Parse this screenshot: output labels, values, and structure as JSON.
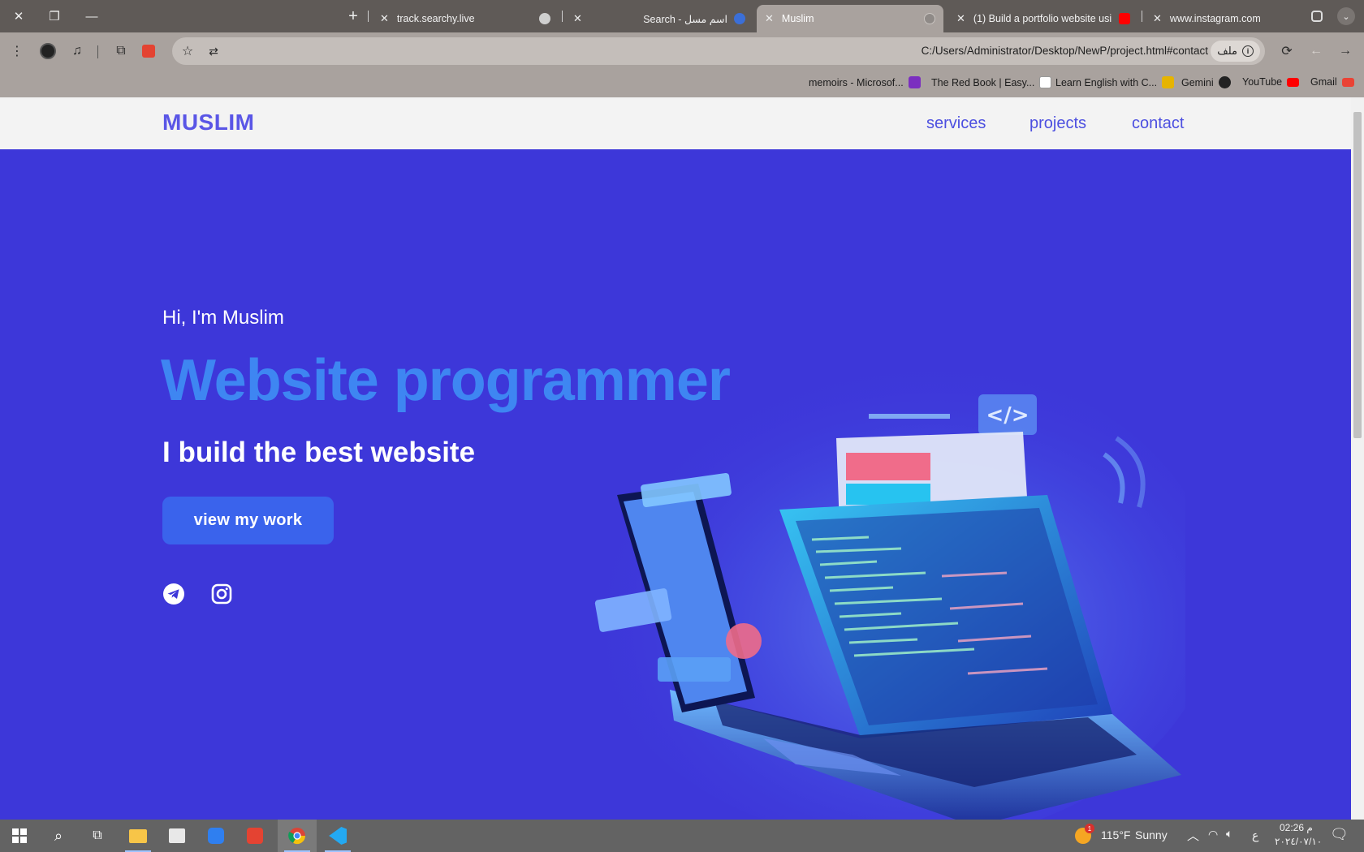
{
  "window_controls": {
    "close": "✕",
    "restore": "❐",
    "minimize": "—"
  },
  "tabs": [
    {
      "label": "track.searchy.live"
    },
    {
      "label": "Search - اسم مسل"
    },
    {
      "label": "Muslim"
    },
    {
      "label": "(1) Build a portfolio website usi"
    },
    {
      "label": "www.instagram.com"
    }
  ],
  "new_tab": "+",
  "address_bar": {
    "url": "C:/Users/Administrator/Desktop/NewP/project.html#contact",
    "site_info": "ملف"
  },
  "bookmarks": [
    {
      "label": "memoirs - Microsof...",
      "color": "#7b2fc0"
    },
    {
      "label": "The Red Book | Easy...",
      "color": "#ffffff"
    },
    {
      "label": "Learn English with C...",
      "color": "#e6b400"
    },
    {
      "label": "Gemini",
      "color": "#222222"
    },
    {
      "label": "YouTube",
      "color": "#ff0000"
    },
    {
      "label": "Gmail",
      "color": "#ea4335"
    }
  ],
  "site": {
    "logo": "MUSLIM",
    "nav": [
      "services",
      "projects",
      "contact"
    ],
    "greeting": "Hi, I'm Muslim",
    "title": "Website programmer",
    "subtitle": "I build the best website",
    "cta": "view my work",
    "social": [
      "telegram-icon",
      "instagram-icon"
    ],
    "colors": {
      "background": "#3d37d9",
      "accent": "#3e86f2",
      "nav_bg": "#f3f3f3",
      "button": "#3a63ec"
    }
  },
  "taskbar": {
    "weather": {
      "temp": "115°F",
      "condition": "Sunny",
      "badge": "1"
    },
    "lang": "ع",
    "time": "02:26 م",
    "date": "٢٠٢٤/٠٧/١٠"
  }
}
